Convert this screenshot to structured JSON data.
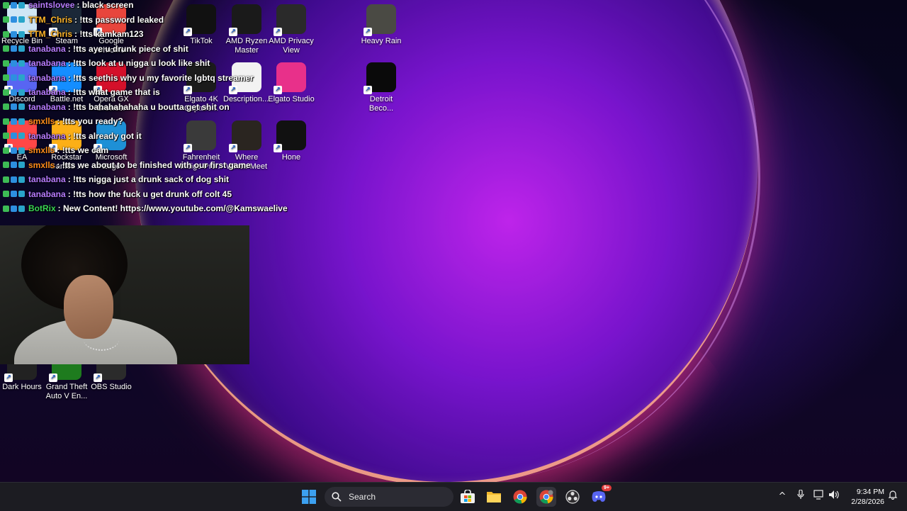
{
  "desktop_icons": [
    {
      "label": "Recycle Bin",
      "icon": "recycle-bin-icon",
      "color": "#cfe6f5"
    },
    {
      "label": "Steam",
      "icon": "steam-icon",
      "color": "#1b2838"
    },
    {
      "label": "Google Chrome",
      "icon": "chrome-icon",
      "color": "#e8453c"
    },
    {
      "label": "TikTok",
      "icon": "tiktok-icon",
      "color": "#111111"
    },
    {
      "label": "AMD Ryzen Master",
      "icon": "amd-ryzen-icon",
      "color": "#1a1a1a"
    },
    {
      "label": "AMD Privacy View",
      "icon": "amd-privacy-icon",
      "color": "#2a2a2a"
    },
    {
      "label": "Heavy Rain",
      "icon": "heavy-rain-icon",
      "color": "#4a4a44"
    },
    {
      "label": "Discord",
      "icon": "discord-icon",
      "color": "#5865f2"
    },
    {
      "label": "Battle.net",
      "icon": "battlenet-icon",
      "color": "#148eff"
    },
    {
      "label": "Opera GX Browser",
      "icon": "opera-gx-icon",
      "color": "#d4102a"
    },
    {
      "label": "Elgato 4K Capture...",
      "icon": "elgato-4k-icon",
      "color": "#1b1b1b"
    },
    {
      "label": "Description....",
      "icon": "text-file-icon",
      "color": "#f2f2f2"
    },
    {
      "label": "Elgato Studio",
      "icon": "elgato-studio-icon",
      "color": "#e8308a"
    },
    {
      "label": "Detroit Beco...",
      "icon": "detroit-icon",
      "color": "#0a0a0a"
    },
    {
      "label": "EA",
      "icon": "ea-icon",
      "color": "#ff4747"
    },
    {
      "label": "Rockstar Games ...",
      "icon": "rockstar-icon",
      "color": "#fcaf17"
    },
    {
      "label": "Microsoft Edge",
      "icon": "edge-icon",
      "color": "#1e90d6"
    },
    {
      "label": "Fahrenheit Indigo Pro...",
      "icon": "fahrenheit-icon",
      "color": "#3a3a3a"
    },
    {
      "label": "Where Winds Meet",
      "icon": "where-winds-meet-icon",
      "color": "#2a2520"
    },
    {
      "label": "Hone",
      "icon": "hone-icon",
      "color": "#111111"
    },
    {
      "label": "Dark Hours",
      "icon": "dark-hours-icon",
      "color": "#222222"
    },
    {
      "label": "Grand Theft Auto V En...",
      "icon": "gta-v-icon",
      "color": "#1e7b1e"
    },
    {
      "label": "OBS Studio",
      "icon": "obs-icon",
      "color": "#2b2b2b"
    }
  ],
  "chat": [
    {
      "user": "saintslovee",
      "text": ": black screen",
      "color": "#b77bff"
    },
    {
      "user": "TTM_Chris",
      "text": ": !tts password leaked",
      "color": "#ffb52a"
    },
    {
      "user": "TTM_Chris",
      "text": ": !tts kamkam123",
      "color": "#ffb52a"
    },
    {
      "user": "tanabana",
      "text": ": !tts aye u drunk piece of shit",
      "color": "#b77bff"
    },
    {
      "user": "tanabana",
      "text": ": !tts look at u nigga u look like shit",
      "color": "#b77bff"
    },
    {
      "user": "tanabana",
      "text": ": !tts seethis why u my favorite lgbtq streamer",
      "color": "#b77bff"
    },
    {
      "user": "tanabana",
      "text": ": !tts what game that is",
      "color": "#b77bff"
    },
    {
      "user": "tanabana",
      "text": ": !tts bahahahahaha u boutta get shit on",
      "color": "#b77bff"
    },
    {
      "user": "smxlls",
      "text": ": !tts you ready?",
      "color": "#ff8c1a"
    },
    {
      "user": "tanabana",
      "text": ": !tts already got it",
      "color": "#b77bff"
    },
    {
      "user": "smxlls",
      "text": ": !tts we cam",
      "color": "#ff8c1a"
    },
    {
      "user": "smxlls",
      "text": ": !tts we about to be finished with our first game",
      "color": "#ff8c1a"
    },
    {
      "user": "tanabana",
      "text": ": !tts nigga just a drunk sack of dog shit",
      "color": "#b77bff"
    },
    {
      "user": "tanabana",
      "text": ": !tts how the fuck u get drunk off colt 45",
      "color": "#b77bff"
    },
    {
      "user": "BotRix",
      "text": ": New Content! https://www.youtube.com/@Kamswaelive",
      "color": "#39d353"
    }
  ],
  "taskbar": {
    "search_label": "Search",
    "time": "9:34 PM",
    "date": "2/28/2026",
    "apps": [
      "start-icon",
      "microsoft-store-icon",
      "file-explorer-icon",
      "chrome-icon",
      "chrome-profile-icon",
      "obs-icon",
      "discord-icon"
    ],
    "discord_badge": "9+"
  }
}
